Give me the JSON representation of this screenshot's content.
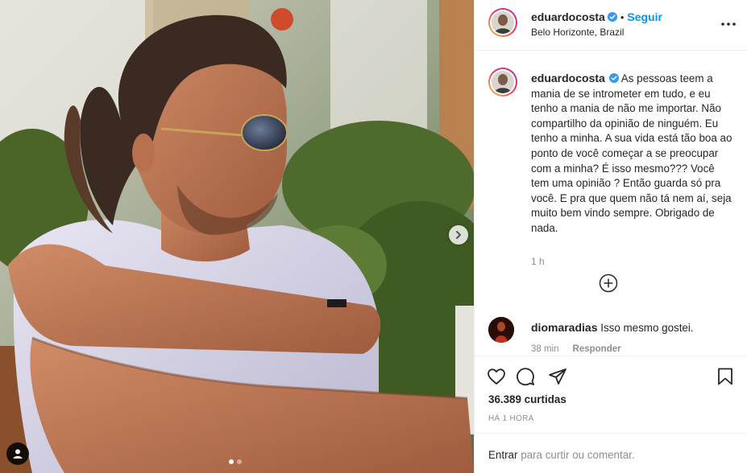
{
  "post": {
    "author": {
      "username": "eduardocosta",
      "verified": true,
      "location": "Belo Horizonte, Brazil",
      "follow_label": "Seguir",
      "separator": "•"
    },
    "caption": "As pessoas teem a mania de se intrometer em tudo, e eu tenho a mania de não me importar. Não compartilho da opinião de ninguém. Eu tenho a minha. A sua vida está tão boa ao ponto de você começar a se preocupar com a minha? É isso mesmo??? Você tem uma opinião ? Então guarda só pra você. E pra que quem não tá nem aí, seja muito bem vindo sempre. Obrigado de nada.",
    "caption_age": "1 h",
    "comments": [
      {
        "username": "diomaradias",
        "text": "Isso mesmo gostei.",
        "age": "38 min",
        "reply_label": "Responder"
      }
    ],
    "likes_text": "36.389 curtidas",
    "posted_ago": "HÁ 1 HORA",
    "comment_prompt": {
      "login_link": "Entrar",
      "rest": "para curtir ou comentar."
    },
    "carousel": {
      "count": 2,
      "active_index": 0
    }
  },
  "icons": {
    "verified": "verified-badge-icon",
    "more": "more-options-icon",
    "next": "chevron-right-icon",
    "tag": "user-tag-icon",
    "load_more": "plus-circle-icon",
    "like": "heart-icon",
    "comment": "comment-icon",
    "share": "paper-plane-icon",
    "save": "bookmark-icon"
  },
  "colors": {
    "link_blue": "#0095f6",
    "text": "#262626",
    "muted": "#8e8e8e",
    "border": "#efefef"
  }
}
